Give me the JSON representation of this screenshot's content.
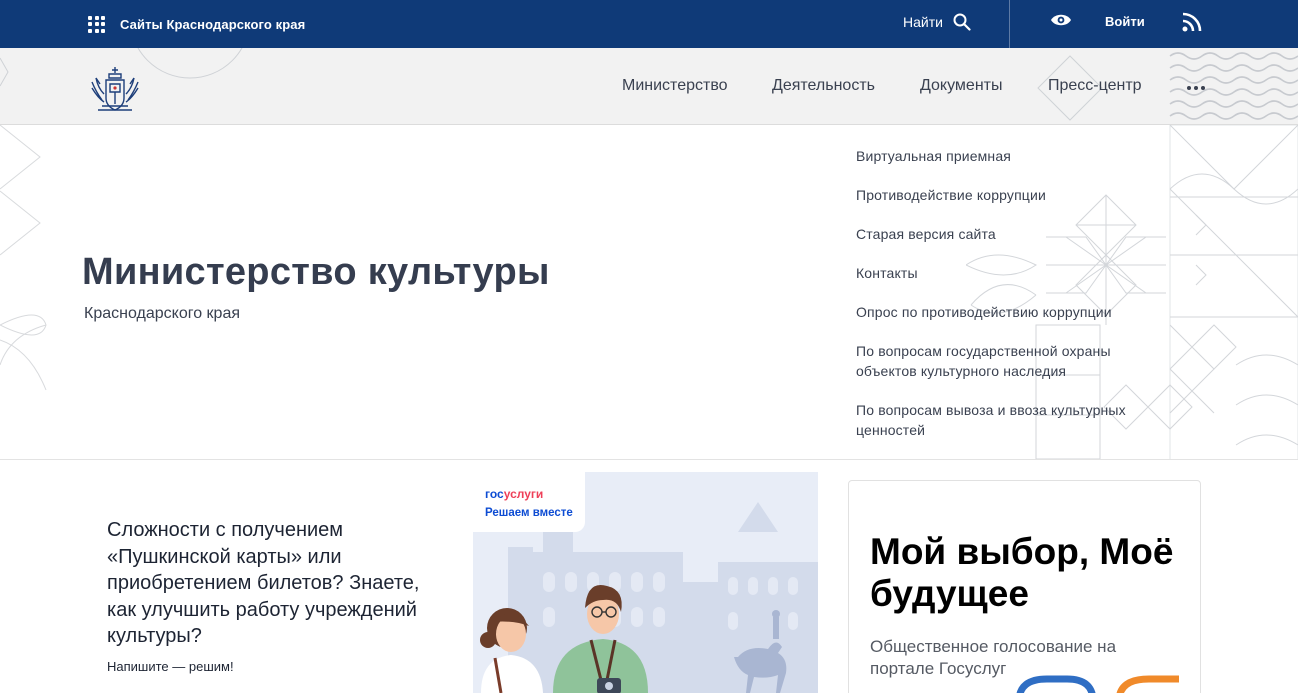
{
  "topbar": {
    "sites_label": "Сайты Краснодарского края",
    "search_label": "Найти",
    "login_label": "Войти",
    "background": "#0f3a78"
  },
  "nav": {
    "items": [
      "Министерство",
      "Деятельность",
      "Документы",
      "Пресс-центр"
    ]
  },
  "hero": {
    "title": "Министерство культуры",
    "subtitle": "Краснодарского края"
  },
  "menu": {
    "items": [
      "Виртуальная приемная",
      "Противодействие коррупции",
      "Старая версия сайта",
      "Контакты",
      "Опрос по противодействию коррупции",
      "По вопросам государственной охраны объектов культурного наследия",
      "По вопросам вывоза и ввоза культурных ценностей"
    ]
  },
  "promo": {
    "question": "Сложности с получением «Пушкинской карты» или приобретением билетов? Знаете, как улучшить работу учреждений культуры?",
    "link": "Напишите — решим!",
    "banner_brand_part1": "гос",
    "banner_brand_part2": "услуги",
    "banner_slogan": "Решаем вместе"
  },
  "vote_card": {
    "title": "Мой выбор, Моё будущее",
    "description": "Общественное голосование на портале Госуслуг"
  },
  "colors": {
    "accent_blue": "#0d4cd3",
    "accent_red": "#ee3f58",
    "text_dark": "#353d4f"
  }
}
